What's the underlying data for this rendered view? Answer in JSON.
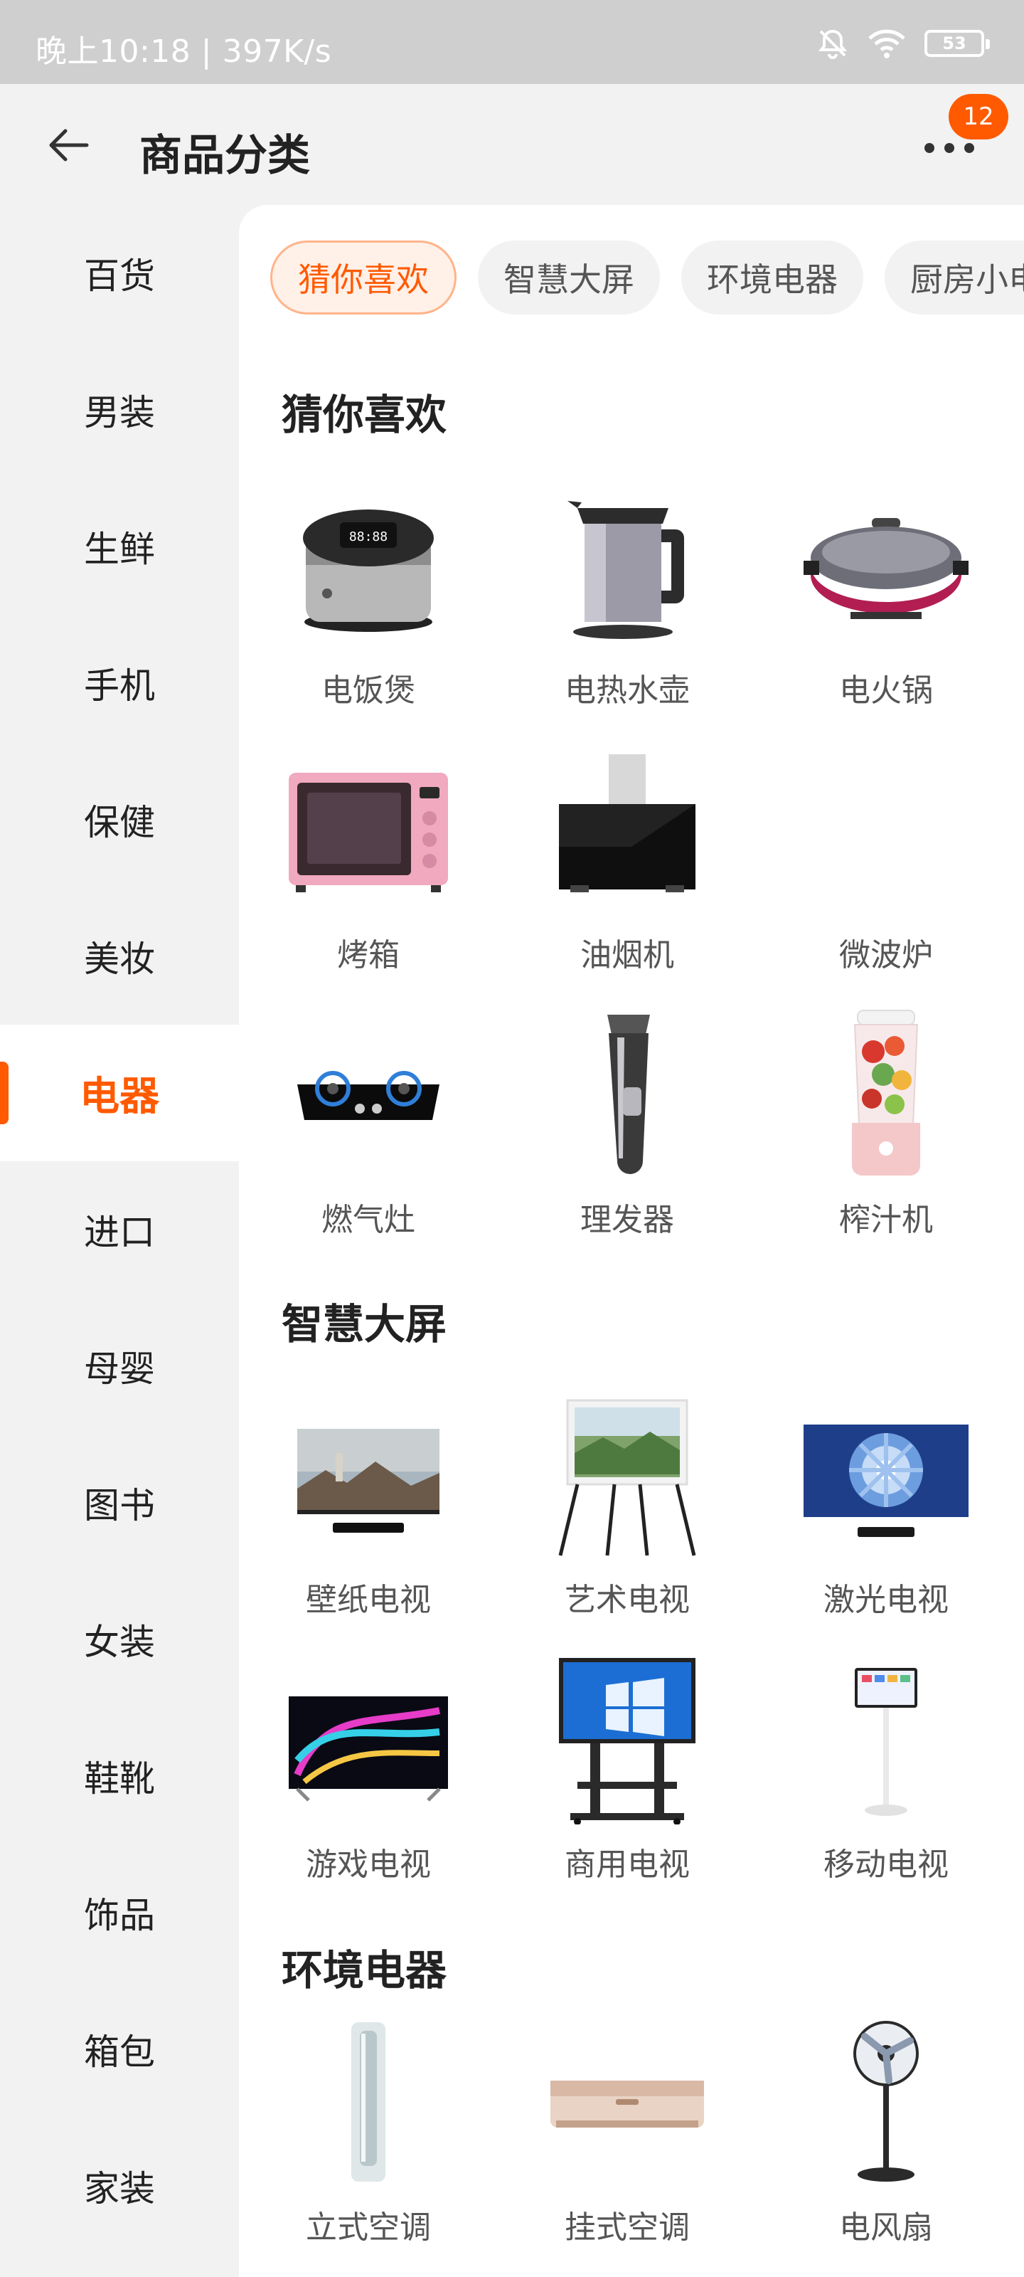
{
  "status_bar": {
    "time": "晚上10:18 | 397K/s",
    "battery": "53"
  },
  "header": {
    "title": "商品分类",
    "badge_count": "12"
  },
  "sidebar": {
    "items": [
      {
        "label": "百货"
      },
      {
        "label": "男装"
      },
      {
        "label": "生鲜"
      },
      {
        "label": "手机"
      },
      {
        "label": "保健"
      },
      {
        "label": "美妆"
      },
      {
        "label": "电器",
        "active": true
      },
      {
        "label": "进口"
      },
      {
        "label": "母婴"
      },
      {
        "label": "图书"
      },
      {
        "label": "女装"
      },
      {
        "label": "鞋靴"
      },
      {
        "label": "饰品"
      },
      {
        "label": "箱包"
      },
      {
        "label": "家装"
      }
    ]
  },
  "chips": [
    {
      "label": "猜你喜欢",
      "active": true
    },
    {
      "label": "智慧大屏"
    },
    {
      "label": "环境电器"
    },
    {
      "label": "厨房小电"
    }
  ],
  "sections": [
    {
      "title": "猜你喜欢",
      "items": [
        {
          "label": "电饭煲",
          "icon": "rice-cooker"
        },
        {
          "label": "电热水壶",
          "icon": "kettle"
        },
        {
          "label": "电火锅",
          "icon": "hot-pot"
        },
        {
          "label": "烤箱",
          "icon": "oven"
        },
        {
          "label": "油烟机",
          "icon": "range-hood"
        },
        {
          "label": "微波炉",
          "icon": "microwave"
        },
        {
          "label": "燃气灶",
          "icon": "gas-stove"
        },
        {
          "label": "理发器",
          "icon": "hair-clipper"
        },
        {
          "label": "榨汁机",
          "icon": "juicer"
        }
      ]
    },
    {
      "title": "智慧大屏",
      "items": [
        {
          "label": "壁纸电视",
          "icon": "wallpaper-tv"
        },
        {
          "label": "艺术电视",
          "icon": "art-tv"
        },
        {
          "label": "激光电视",
          "icon": "laser-tv"
        },
        {
          "label": "游戏电视",
          "icon": "gaming-tv"
        },
        {
          "label": "商用电视",
          "icon": "commercial-tv"
        },
        {
          "label": "移动电视",
          "icon": "mobile-tv"
        }
      ]
    },
    {
      "title": "环境电器",
      "items": [
        {
          "label": "立式空调",
          "icon": "floor-ac"
        },
        {
          "label": "挂式空调",
          "icon": "wall-ac"
        },
        {
          "label": "电风扇",
          "icon": "electric-fan"
        }
      ]
    }
  ]
}
